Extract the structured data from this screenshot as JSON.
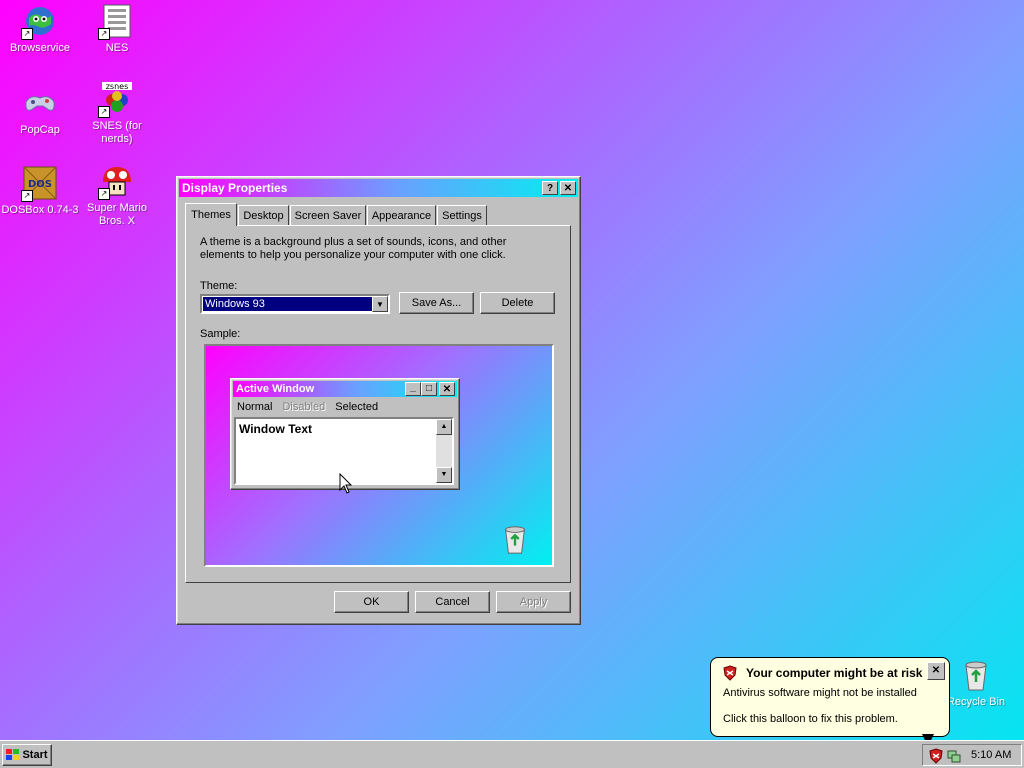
{
  "desktop": {
    "icons": [
      {
        "label": "Browservice"
      },
      {
        "label": "NES"
      },
      {
        "label": "PopCap"
      },
      {
        "label": "SNES (for nerds)"
      },
      {
        "label": "DOSBox 0.74-3"
      },
      {
        "label": "Super Mario Bros. X"
      },
      {
        "label": "Recycle Bin"
      }
    ]
  },
  "dialog": {
    "title": "Display Properties",
    "help_glyph": "?",
    "close_glyph": "✕",
    "tabs": [
      {
        "label": "Themes"
      },
      {
        "label": "Desktop"
      },
      {
        "label": "Screen Saver"
      },
      {
        "label": "Appearance"
      },
      {
        "label": "Settings"
      }
    ],
    "description": "A theme is a background plus a set of sounds, icons, and other elements to help you personalize your computer with one click.",
    "theme_label": "Theme:",
    "theme_value": "Windows 93",
    "save_as": "Save As...",
    "delete": "Delete",
    "sample_label": "Sample:",
    "sample": {
      "title": "Active Window",
      "menu": [
        "Normal",
        "Disabled",
        "Selected"
      ],
      "text": "Window Text"
    },
    "ok": "OK",
    "cancel": "Cancel",
    "apply": "Apply"
  },
  "balloon": {
    "title": "Your computer might be at risk",
    "line1": "Antivirus software might not be installed",
    "line2": "Click this balloon to fix this problem."
  },
  "taskbar": {
    "start": "Start",
    "clock": "5:10 AM"
  },
  "colors": {
    "title_gradient": [
      "#ff00ff",
      "#00f0f0"
    ],
    "face": "#c0c0c0",
    "combo_highlight": "#000080"
  }
}
